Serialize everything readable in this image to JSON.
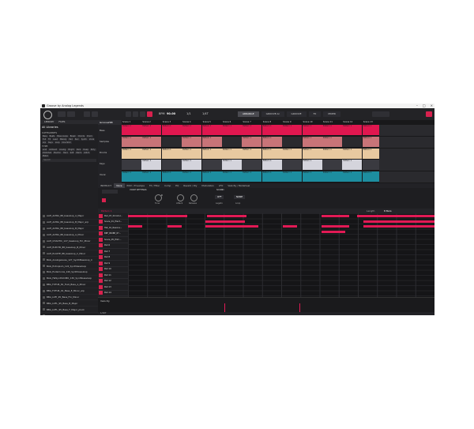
{
  "window": {
    "title": "Groove by Analog Legends"
  },
  "toolbar": {
    "bpm_label": "BPM",
    "bpm": "90.00",
    "signature": "1/1",
    "edit_label": "1/4T",
    "views": [
      "ARRANGE",
      "GROOVE.AI",
      "GROOVE",
      "FX",
      "MIXER"
    ],
    "selected_view": "ARRANGE"
  },
  "left_panel": {
    "tabs": [
      "LIBRARY",
      "FILES"
    ],
    "title": "All Libraries",
    "section_category": "CATEGORIES",
    "section_type": "TYPE",
    "tags_category": [
      "Bass",
      "Beats",
      "Bass Loops",
      "Break",
      "Chords",
      "Drum",
      "Full",
      "FX",
      "Lead",
      "Melody",
      "Pad",
      "Perc",
      "Synth",
      "Vocal",
      "Arp",
      "Keys",
      "Loop",
      "One Shot"
    ],
    "tags_type": [
      "Acid",
      "Ambient",
      "Analog",
      "Bright",
      "Dark",
      "Deep",
      "Dirty",
      "Distorted",
      "Electric",
      "Hard",
      "Soft",
      "Warm",
      "Glitch",
      "Metal"
    ],
    "search_placeholder": "Search",
    "items": [
      "AAH_ALTRA_88_bassloop_A_Major",
      "AAH_ALTRA_88_bassloop_B_Major_arp",
      "AAH_ALTRA_88_bassloop_B_Major",
      "AAH_ALTRA_88_bassloop_A_Minor",
      "AAH_CHAOTIC_127_bassloop_Fm_Minor",
      "AAH_ELECTR_88_bassloop_B_Minor",
      "AAH_PLASTE_88_bassloop_C_Minor",
      "BAG_Analogwaves_127_SynthBassloop_C",
      "BAG_Entropism_124_Synthbassloop",
      "BAG_Eudamonia_140_Synthbassloop",
      "BAG_FatSynthCOMO_130_Synthbassloop",
      "BBA_FUTUR_81_Fuzz_Bass_A_Minor",
      "BBA_FUTUR_91_Bass_E_Minor_arp",
      "BBA_LOFI_95_Bass_Fm_Minor",
      "BBA_LOFL_95_Bass_B_Major",
      "BBA_LOFL_95_Bass_F_Major_pluck",
      "BBF_BRIBE_80_bassloop_F#_Minor",
      "BBF_BRIGHT_86_bassloop_Fm_Minor",
      "BBF_FIZZOFF_95_bassloop_Em_Minor",
      "BBF_SCALP_87_bassloop_Fm_Minor",
      "BBF_SHOW_84_bassloop_E_Minor",
      "CHC_BOMB_118_bassloop_Am_Minor",
      "CHC_CREME_98_808bass_Fm_Minor",
      "CHC_GROVE_128_bassloop_F#_Minor"
    ]
  },
  "arranger": {
    "group_title": "Groove268",
    "groups": [
      "Bass",
      "Samples",
      "Drums",
      "Keys",
      "Vocal"
    ],
    "scenes": [
      "Scene 1",
      "Scene 2",
      "Scene 3",
      "Scene 4",
      "Scene 5",
      "Scene 6",
      "Scene 7",
      "Scene 8",
      "Scene 9",
      "Scene 10",
      "Scene 11",
      "Scene 12",
      "Scene 13"
    ],
    "clip_label": "Pattern 1"
  },
  "midbar": {
    "tabs": [
      "INSTRUCT",
      "Voice",
      "Pitch / Envelope",
      "FX / Filter",
      "Comp",
      "EQ",
      "Reverb / Dly",
      "Modulation",
      "LFO",
      "Velocity / Modwheel"
    ],
    "selected_tab": "Voice"
  },
  "settings": {
    "voice_settings_label": "VOICE SETTINGS",
    "sound_label": "SOUND",
    "tune_label": "Tune",
    "tune_value": "0",
    "poly_label": "Polyphony",
    "attack_label": "Attack",
    "release_label": "Release",
    "off_label": "OFF",
    "none_label": "NONE",
    "legato_label": "Legato",
    "loop_label": "Loop"
  },
  "piano": {
    "pattern_name": "Pattern 1",
    "length_label": "Length",
    "length_value": "8 Bars",
    "keys": [
      "Ped_07_Kmodul...",
      "Snare_01_Elect...",
      "Hat_01_Resona...",
      "BBF_BRIBE_87...",
      "Snare_05_Elim...",
      "Pad 6",
      "Pad 7",
      "Pad 8",
      "Pad 9",
      "Pad 10",
      "Pad 11",
      "Pad 12",
      "Pad 13",
      "Pad 14",
      "Pad 15",
      "Pad 16"
    ],
    "velocity_label": "Velocity",
    "footer": "1/16T"
  },
  "colors": {
    "accent": "#e21a55",
    "lane_colors": [
      "#e0174f",
      "#c87478",
      "#e8c9a0",
      "#d4d4dc",
      "#1d8ea0"
    ]
  }
}
